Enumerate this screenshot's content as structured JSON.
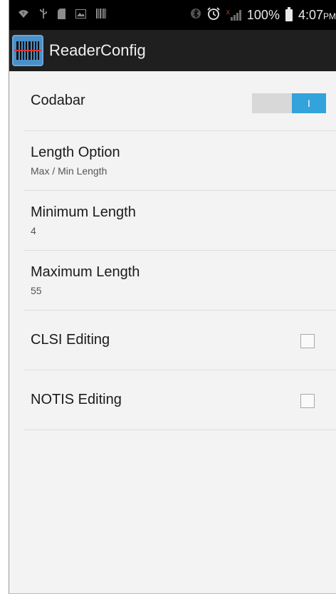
{
  "status_bar": {
    "battery_percent": "100%",
    "time": "4:07",
    "time_suffix": "PM",
    "icons": [
      "wifi-icon",
      "usb-icon",
      "sd-card-icon",
      "image-icon",
      "barcode-notification-icon",
      "bluetooth-icon",
      "alarm-icon",
      "signal-icon",
      "battery-icon"
    ]
  },
  "action_bar": {
    "title": "ReaderConfig",
    "icon": "barcode-scanner-icon"
  },
  "preferences": [
    {
      "title": "Codabar",
      "control": "switch",
      "switch_label": "I",
      "checked": true
    },
    {
      "title": "Length Option",
      "summary": "Max / Min Length"
    },
    {
      "title": "Minimum Length",
      "summary": "4"
    },
    {
      "title": "Maximum Length",
      "summary": "55"
    },
    {
      "title": "CLSI Editing",
      "control": "checkbox",
      "checked": false
    },
    {
      "title": "NOTIS Editing",
      "control": "checkbox",
      "checked": false
    }
  ],
  "colors": {
    "accent": "#33a3dc",
    "action_bar": "#1f1f1f",
    "status_bar": "#000000",
    "background": "#f3f3f3"
  }
}
